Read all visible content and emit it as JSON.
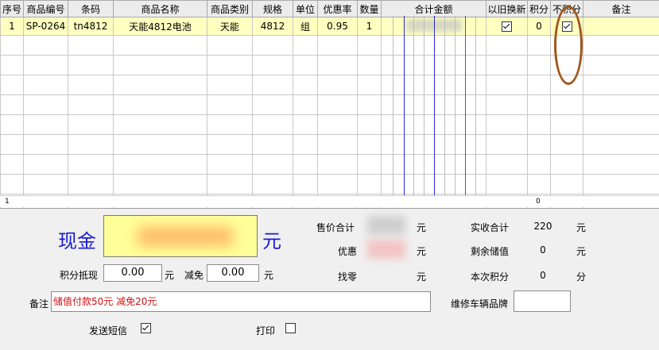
{
  "grid": {
    "columns": [
      "序号",
      "商品编号",
      "条码",
      "商品名称",
      "商品类别",
      "规格",
      "单位",
      "优惠率",
      "数量",
      "合计金额",
      "以旧换新",
      "积分",
      "不积分",
      "备注"
    ],
    "row": {
      "index": "1",
      "code": "SP-0264",
      "barcode": "tn4812",
      "name": "天能4812电池",
      "category": "天能",
      "spec": "4812",
      "unit": "组",
      "discount": "0.95",
      "qty": "1",
      "trade_in_checked": true,
      "points": "0",
      "no_points_checked": true,
      "remark": ""
    },
    "footer_count": "1",
    "footer_points": "0"
  },
  "payment": {
    "cash_label": "现金",
    "cash_unit": "元",
    "points_offset_label": "积分抵现",
    "points_offset_value": "0.00",
    "points_offset_unit": "元",
    "deduct_label": "减免",
    "deduct_value": "0.00",
    "deduct_unit": "元",
    "remark_label": "备注",
    "remark_value": "储值付款50元 减免20元",
    "sms_label": "发送短信",
    "sms_checked": true,
    "print_label": "打印",
    "print_checked": false
  },
  "summary": {
    "sale_total_label": "售价合计",
    "sale_total_unit": "元",
    "discount_label": "优惠",
    "discount_unit": "元",
    "change_label": "找零",
    "change_unit": "元",
    "received_label": "实收合计",
    "received_value": "220",
    "received_unit": "元",
    "balance_label": "剩余储值",
    "balance_value": "0",
    "balance_unit": "元",
    "points_label": "本次积分",
    "points_value": "0",
    "points_unit": "分",
    "brand_label": "维修车辆品牌",
    "brand_value": ""
  }
}
